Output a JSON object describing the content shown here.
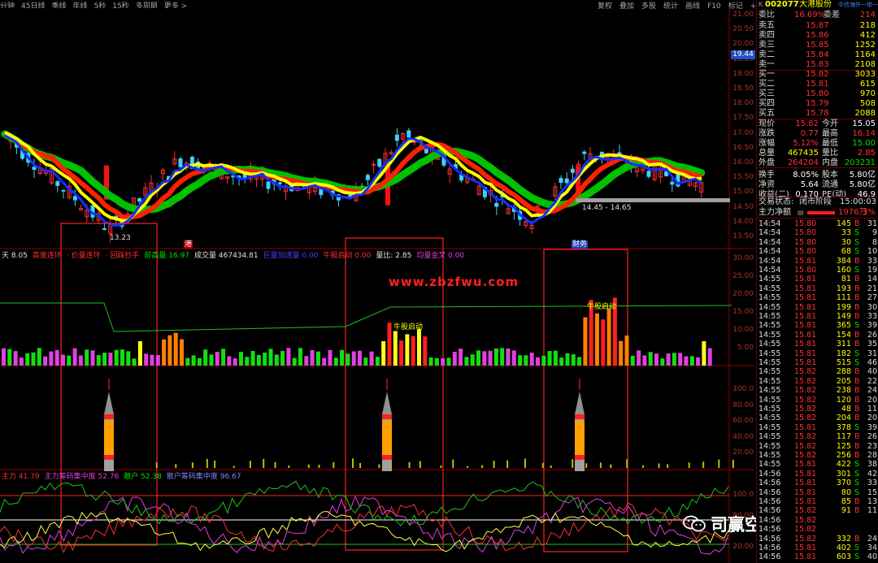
{
  "toolbar": {
    "left": [
      "分钟",
      "45日线",
      "季线",
      "年线",
      "5秒",
      "15秒",
      "多周期",
      "更多 >"
    ],
    "right": [
      "复权",
      "叠加",
      "多股",
      "统计",
      "画线",
      "F10",
      "标记",
      "+自选",
      "返回"
    ]
  },
  "main_chart": {
    "y_axis": [
      "21.00",
      "20.50",
      "20.00",
      "19.50",
      "19.00",
      "18.50",
      "18.00",
      "17.50",
      "17.00",
      "16.50",
      "16.00",
      "15.50",
      "15.00",
      "14.50",
      "14.00",
      "13.50"
    ],
    "current_price_tag": "19.44",
    "low_label": "13.23",
    "range_label": "14.45 - 14.65",
    "event_markers": [
      "港",
      "财务"
    ]
  },
  "volume_indicator": {
    "labels": [
      {
        "text": "天 8.05",
        "color": "#e0e0e0"
      },
      {
        "text": "高度连环",
        "color": "#ff3030"
      },
      {
        "text": "· 价量连环",
        "color": "#ff3030"
      },
      {
        "text": "· 回踩抄手",
        "color": "#ff3030"
      },
      {
        "text": "前高量 16.97",
        "color": "#00e000"
      },
      {
        "text": "成交量 467434.81",
        "color": "#e0e0e0"
      },
      {
        "text": "巨量加速量 0.00",
        "color": "#4040ff"
      },
      {
        "text": "牛股启动 0.00",
        "color": "#ff3030"
      },
      {
        "text": "量比: 2.85",
        "color": "#e0e0e0"
      },
      {
        "text": "均量金叉 0.00",
        "color": "#e040e0"
      }
    ],
    "y_axis": [
      "30.00",
      "25.00",
      "20.00",
      "15.00",
      "10.00",
      "5.00"
    ],
    "watermark": "www.zbzfwu.com",
    "annotations": [
      "牛股启动",
      "牛股启动"
    ]
  },
  "rocket_panel": {
    "y_axis": [
      "100.0",
      "80.00",
      "60.00",
      "40.00",
      "20.00"
    ]
  },
  "bottom_indicator": {
    "labels": [
      {
        "text": "主力 41.79",
        "color": "#ff3030"
      },
      {
        "text": "主力筹码集中度 52.76",
        "color": "#e040e0"
      },
      {
        "text": "散户 52.38",
        "color": "#00e000"
      },
      {
        "text": "散户筹码集中度 96.67",
        "color": "#8080ff"
      }
    ],
    "y_axis": [
      "100.0",
      "80.00",
      "20.00"
    ]
  },
  "watermark_brand": "司赢空指标所",
  "quote": {
    "code": "002077",
    "name": "大港股份",
    "subtitle": "中信海外一带一路",
    "weibi_label": "委比",
    "weibi": "16.69%",
    "weicha_label": "委差",
    "weicha": "214",
    "asks": [
      {
        "label": "卖五",
        "price": "15.87",
        "vol": "218"
      },
      {
        "label": "卖四",
        "price": "15.86",
        "vol": "412"
      },
      {
        "label": "卖三",
        "price": "15.85",
        "vol": "1252"
      },
      {
        "label": "卖二",
        "price": "15.84",
        "vol": "1164"
      },
      {
        "label": "卖一",
        "price": "15.83",
        "vol": "2108"
      }
    ],
    "bids": [
      {
        "label": "买一",
        "price": "15.82",
        "vol": "3033"
      },
      {
        "label": "买二",
        "price": "15.81",
        "vol": "615"
      },
      {
        "label": "买三",
        "price": "15.80",
        "vol": "970"
      },
      {
        "label": "买四",
        "price": "15.79",
        "vol": "508"
      },
      {
        "label": "买五",
        "price": "15.78",
        "vol": "2088"
      }
    ],
    "stats": [
      {
        "l1": "现价",
        "v1": "15.82",
        "l2": "今开",
        "v2": "15.05",
        "c1": "#ff3030",
        "c2": "#ffffff"
      },
      {
        "l1": "涨跌",
        "v1": "0.77",
        "l2": "最高",
        "v2": "16.14",
        "c1": "#ff3030",
        "c2": "#ff3030"
      },
      {
        "l1": "涨幅",
        "v1": "5.12%",
        "l2": "最低",
        "v2": "15.00",
        "c1": "#ff3030",
        "c2": "#00e000"
      },
      {
        "l1": "总量",
        "v1": "467435",
        "l2": "量比",
        "v2": "2.85",
        "c1": "#ffff00",
        "c2": "#ff3030"
      },
      {
        "l1": "外盘",
        "v1": "264204",
        "l2": "内盘",
        "v2": "203231",
        "c1": "#ff3030",
        "c2": "#00e000"
      },
      {
        "l1": "换手",
        "v1": "8.05%",
        "l2": "股本",
        "v2": "5.80亿",
        "c1": "#ffffff",
        "c2": "#ffffff"
      },
      {
        "l1": "净资",
        "v1": "5.64",
        "l2": "流通",
        "v2": "5.80亿",
        "c1": "#ffffff",
        "c2": "#ffffff"
      },
      {
        "l1": "收益(二)",
        "v1": "0.170",
        "l2": "PE(动)",
        "v2": "46.9",
        "c1": "#ffffff",
        "c2": "#ffffff"
      }
    ],
    "trade_status_label": "交易状态:",
    "trade_status": "闭市阶段",
    "trade_status_time": "15:00:03",
    "main_net_label": "主力净额",
    "main_net_value": "1976万",
    "main_net_pct": "3%"
  },
  "ticks": [
    {
      "t": "14:54",
      "p": "15.80",
      "v": "145",
      "d": "B",
      "n": "31"
    },
    {
      "t": "14:54",
      "p": "15.80",
      "v": "33",
      "d": "S",
      "n": "9"
    },
    {
      "t": "14:54",
      "p": "15.80",
      "v": "30",
      "d": "S",
      "n": "8"
    },
    {
      "t": "14:54",
      "p": "15.80",
      "v": "68",
      "d": "S",
      "n": "10"
    },
    {
      "t": "14:54",
      "p": "15.81",
      "v": "384",
      "d": "B",
      "n": "33"
    },
    {
      "t": "14:54",
      "p": "15.80",
      "v": "160",
      "d": "S",
      "n": "19"
    },
    {
      "t": "14:55",
      "p": "15.81",
      "v": "81",
      "d": "B",
      "n": "14"
    },
    {
      "t": "14:55",
      "p": "15.81",
      "v": "193",
      "d": "B",
      "n": "21"
    },
    {
      "t": "14:55",
      "p": "15.81",
      "v": "111",
      "d": "B",
      "n": "27"
    },
    {
      "t": "14:55",
      "p": "15.81",
      "v": "199",
      "d": "B",
      "n": "30"
    },
    {
      "t": "14:55",
      "p": "15.81",
      "v": "149",
      "d": "B",
      "n": "33"
    },
    {
      "t": "14:55",
      "p": "15.81",
      "v": "365",
      "d": "S",
      "n": "39"
    },
    {
      "t": "14:55",
      "p": "15.81",
      "v": "154",
      "d": "B",
      "n": "26"
    },
    {
      "t": "14:55",
      "p": "15.81",
      "v": "311",
      "d": "B",
      "n": "35"
    },
    {
      "t": "14:55",
      "p": "15.81",
      "v": "182",
      "d": "S",
      "n": "31"
    },
    {
      "t": "14:55",
      "p": "15.81",
      "v": "515",
      "d": "S",
      "n": "46"
    },
    {
      "t": "14:55",
      "p": "15.82",
      "v": "288",
      "d": "B",
      "n": "40"
    },
    {
      "t": "14:55",
      "p": "15.82",
      "v": "205",
      "d": "B",
      "n": "22"
    },
    {
      "t": "14:55",
      "p": "15.82",
      "v": "238",
      "d": "B",
      "n": "24"
    },
    {
      "t": "14:55",
      "p": "15.82",
      "v": "120",
      "d": "B",
      "n": "20"
    },
    {
      "t": "14:55",
      "p": "15.82",
      "v": "48",
      "d": "B",
      "n": "11"
    },
    {
      "t": "14:55",
      "p": "15.82",
      "v": "204",
      "d": "B",
      "n": "20"
    },
    {
      "t": "14:55",
      "p": "15.81",
      "v": "378",
      "d": "S",
      "n": "39"
    },
    {
      "t": "14:55",
      "p": "15.82",
      "v": "117",
      "d": "B",
      "n": "26"
    },
    {
      "t": "14:55",
      "p": "15.82",
      "v": "125",
      "d": "B",
      "n": "23"
    },
    {
      "t": "14:55",
      "p": "15.82",
      "v": "256",
      "d": "B",
      "n": "28"
    },
    {
      "t": "14:55",
      "p": "15.81",
      "v": "422",
      "d": "S",
      "n": "38"
    },
    {
      "t": "14:56",
      "p": "15.81",
      "v": "301",
      "d": "S",
      "n": "42"
    },
    {
      "t": "14:56",
      "p": "15.81",
      "v": "370",
      "d": "S",
      "n": "33"
    },
    {
      "t": "14:56",
      "p": "15.81",
      "v": "80",
      "d": "S",
      "n": "15"
    },
    {
      "t": "14:56",
      "p": "15.81",
      "v": "85",
      "d": "B",
      "n": "13"
    },
    {
      "t": "14:56",
      "p": "15.82",
      "v": "91",
      "d": "B",
      "n": "11"
    },
    {
      "t": "14:56",
      "p": "15.82",
      "v": "",
      "d": "",
      "n": ""
    },
    {
      "t": "14:56",
      "p": "15.82",
      "v": "",
      "d": "",
      "n": ""
    },
    {
      "t": "14:56",
      "p": "15.82",
      "v": "332",
      "d": "B",
      "n": "24"
    },
    {
      "t": "14:56",
      "p": "15.81",
      "v": "402",
      "d": "S",
      "n": "34"
    },
    {
      "t": "14:56",
      "p": "15.81",
      "v": "603",
      "d": "S",
      "n": "40"
    }
  ]
}
